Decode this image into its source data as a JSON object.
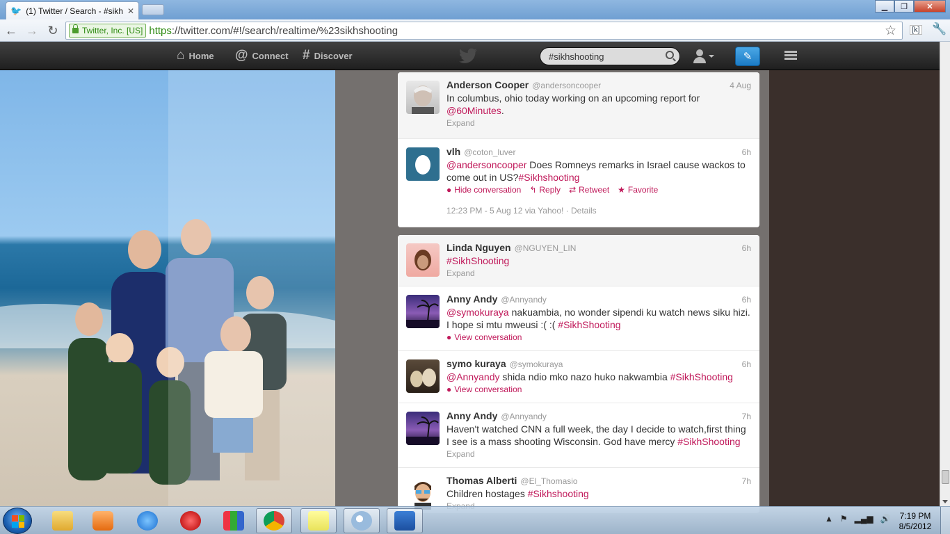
{
  "browser": {
    "tab_title": "(1) Twitter / Search - #sikh",
    "ev_cert": "Twitter, Inc. [US]",
    "url_scheme": "https",
    "url_rest": "://twitter.com/#!/search/realtime/%23sikhshooting",
    "extension_label": "[k]"
  },
  "topbar": {
    "home": "Home",
    "connect": "Connect",
    "discover": "Discover",
    "search_value": "#sikhshooting"
  },
  "tweets_card1": [
    {
      "fullname": "Anderson Cooper",
      "username": "@andersoncooper",
      "time": "4 Aug",
      "text": "In columbus, ohio today working on an upcoming report for",
      "link": "@60Minutes",
      "text_after": ".",
      "expand": "Expand"
    },
    {
      "fullname": "vlh",
      "username": "@coton_luver",
      "time": "6h",
      "mention": "@andersoncooper",
      "text": " Does Romneys remarks in Israel cause wackos to come out in US?",
      "hashtag": "#Sikhshooting",
      "hide_conversation": "Hide conversation",
      "reply": "Reply",
      "retweet": "Retweet",
      "favorite": "Favorite",
      "details_meta": "12:23 PM - 5 Aug 12 via Yahoo! · Details"
    }
  ],
  "tweets_card2": [
    {
      "fullname": "Linda Nguyen",
      "username": "@NGUYEN_LIN",
      "time": "6h",
      "hashtag": "#SikhShooting",
      "expand": "Expand"
    },
    {
      "fullname": "Anny Andy",
      "username": "@Annyandy",
      "time": "6h",
      "mention": "@symokuraya",
      "text": " nakuambia, no wonder sipendi ku watch news siku hizi. I hope si mtu mweusi :( :( ",
      "hashtag": "#SikhShooting",
      "view_conversation": "View conversation"
    },
    {
      "fullname": "symo kuraya",
      "username": "@symokuraya",
      "time": "6h",
      "mention": "@Annyandy",
      "text": " shida ndio mko nazo huko nakwambia ",
      "hashtag": "#SikhShooting",
      "view_conversation": "View conversation"
    },
    {
      "fullname": "Anny Andy",
      "username": "@Annyandy",
      "time": "7h",
      "text": "Haven't watched CNN a full week, the day I decide to watch,first thing I see is a mass shooting Wisconsin. God have mercy ",
      "hashtag": "#SikhShooting",
      "expand": "Expand"
    },
    {
      "fullname": "Thomas Alberti",
      "username": "@El_Thomasio",
      "time": "7h",
      "text": "Children hostages ",
      "hashtag": "#Sikhshooting",
      "expand": "Expand"
    }
  ],
  "taskbar": {
    "clock_time": "7:19 PM",
    "clock_date": "8/5/2012"
  },
  "colors": {
    "link": "#c0195a",
    "topbar": "#2b2b2b",
    "compose": "#1c7bc5"
  }
}
